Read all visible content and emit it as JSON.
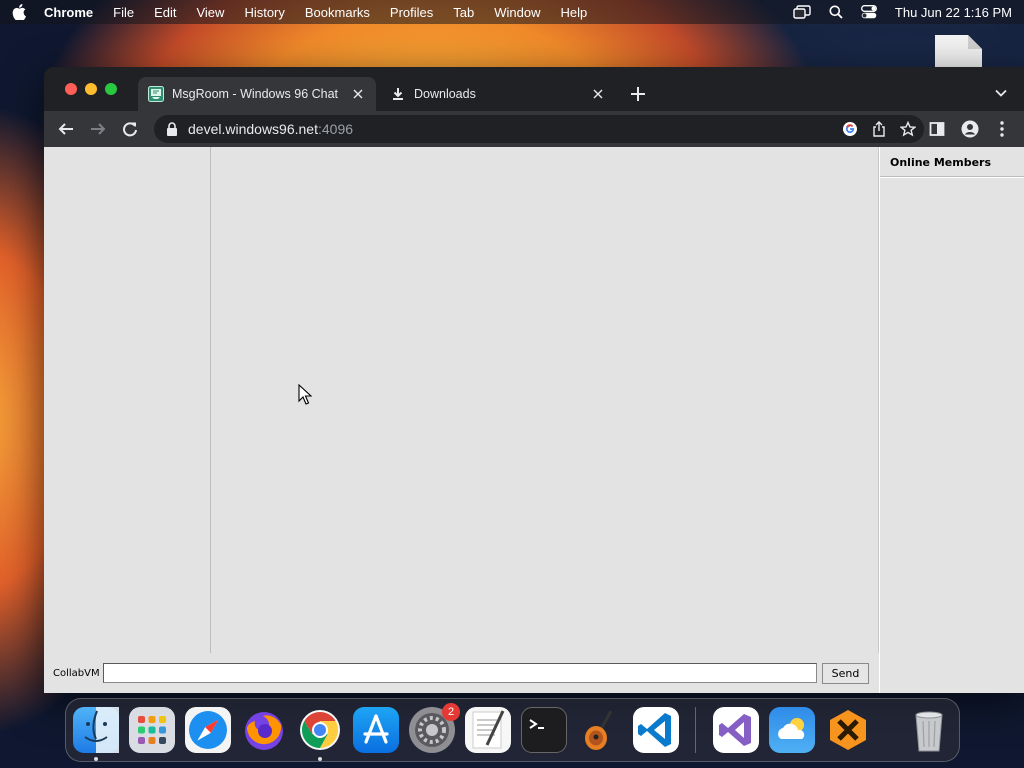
{
  "menubar": {
    "app_name": "Chrome",
    "items": [
      "File",
      "Edit",
      "View",
      "History",
      "Bookmarks",
      "Profiles",
      "Tab",
      "Window",
      "Help"
    ],
    "clock": "Thu Jun 22  1:16 PM"
  },
  "browser": {
    "tabs": [
      {
        "title": "MsgRoom - Windows 96 Chat",
        "icon": "msgroom-favicon",
        "active": true
      },
      {
        "title": "Downloads",
        "icon": "download-icon",
        "active": false
      }
    ],
    "url": {
      "host": "devel.windows96.net",
      "port": ":4096"
    }
  },
  "page": {
    "members_header": "Online Members",
    "username": "CollabVM",
    "message_value": "",
    "send_label": "Send"
  },
  "dock": {
    "apps": [
      "finder",
      "launchpad",
      "safari",
      "firefox",
      "chrome",
      "app-store",
      "system-settings",
      "textedit",
      "terminal",
      "garageband",
      "vscode",
      "visual-studio",
      "weather",
      "bee-app",
      "trash"
    ],
    "settings_badge": "2"
  }
}
